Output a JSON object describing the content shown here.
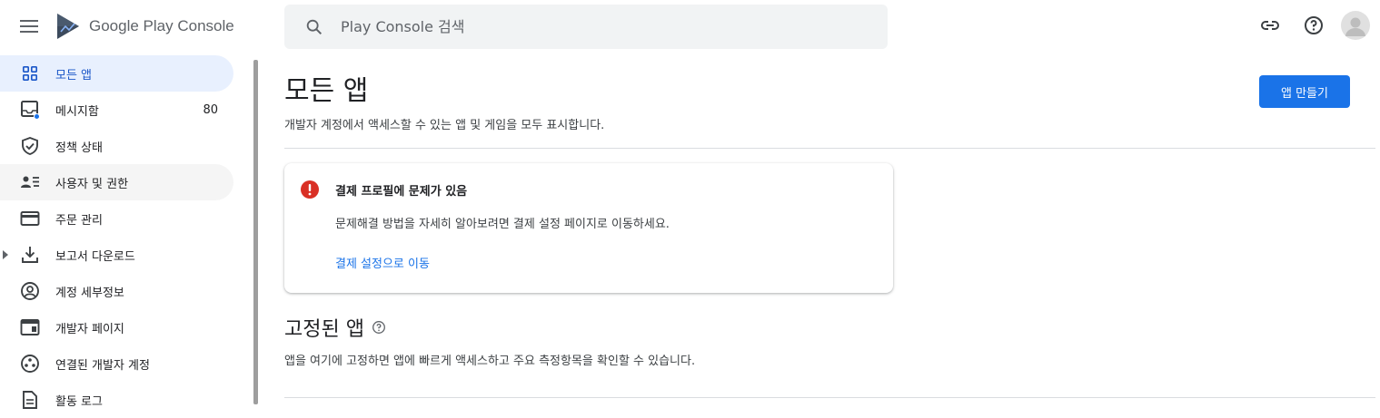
{
  "app": {
    "title": "Google Play Console"
  },
  "search": {
    "placeholder": "Play Console 검색"
  },
  "sidebar": {
    "items": [
      {
        "label": "모든 앱",
        "icon": "grid-icon",
        "active": true
      },
      {
        "label": "메시지함",
        "icon": "inbox-icon",
        "count": "80"
      },
      {
        "label": "정책 상태",
        "icon": "shield-check-icon"
      },
      {
        "label": "사용자 및 권한",
        "icon": "people-list-icon"
      },
      {
        "label": "주문 관리",
        "icon": "credit-card-icon"
      },
      {
        "label": "보고서 다운로드",
        "icon": "download-icon",
        "expandable": true
      },
      {
        "label": "계정 세부정보",
        "icon": "account-circle-icon"
      },
      {
        "label": "개발자 페이지",
        "icon": "web-page-icon"
      },
      {
        "label": "연결된 개발자 계정",
        "icon": "linked-accounts-icon"
      },
      {
        "label": "활동 로그",
        "icon": "document-icon"
      }
    ]
  },
  "main": {
    "title": "모든 앱",
    "subtitle": "개발자 계정에서 액세스할 수 있는 앱 및 게임을 모두 표시합니다.",
    "create_button": "앱 만들기",
    "alert": {
      "title": "결제 프로필에 문제가 있음",
      "body": "문제해결 방법을 자세히 알아보려면 결제 설정 페이지로 이동하세요.",
      "link": "결제 설정으로 이동"
    },
    "pinned": {
      "title": "고정된 앱",
      "subtitle": "앱을 여기에 고정하면 앱에 빠르게 액세스하고 주요 측정항목을 확인할 수 있습니다."
    }
  },
  "colors": {
    "accent": "#1a73e8",
    "active_bg": "#e8f0fe",
    "error": "#d93025"
  }
}
